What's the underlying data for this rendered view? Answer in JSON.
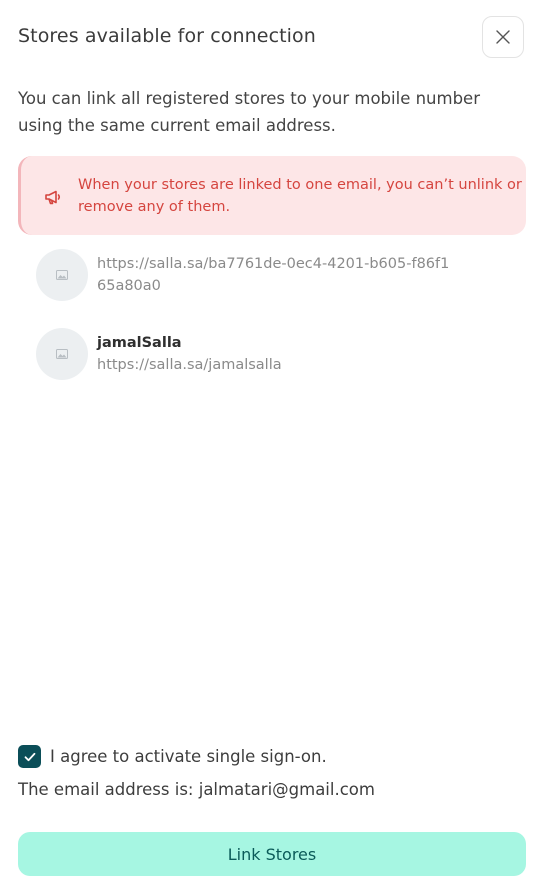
{
  "dialog": {
    "title": "Stores available for connection",
    "description": "You can link all registered stores to your mobile number using the same current email address."
  },
  "alert": {
    "text": "When your stores are linked to one email, you can’t unlink or remove any of them.",
    "icon": "megaphone-icon",
    "color": "#d5453f",
    "background": "#fde6e7"
  },
  "stores": [
    {
      "name": "",
      "url": "https://salla.sa/ba7761de-0ec4-4201-b605-f86f165a80a0"
    },
    {
      "name": "jamalSalla",
      "url": "https://salla.sa/jamalsalla"
    }
  ],
  "agreement": {
    "checked": true,
    "label": "I agree to activate single sign-on.",
    "email_line": "The email address is: jalmatari@gmail.com"
  },
  "actions": {
    "link_label": "Link Stores",
    "link_color": "#a6f6e2"
  },
  "colors": {
    "accent": "#0b4e58"
  }
}
